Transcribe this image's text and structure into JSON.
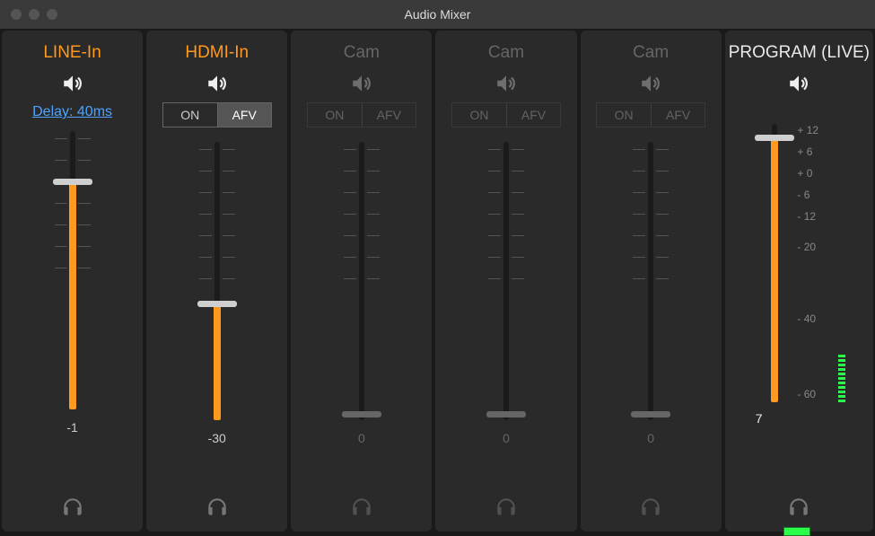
{
  "window": {
    "title": "Audio Mixer"
  },
  "channels": [
    {
      "id": "line-in",
      "title": "LINE-In",
      "titleClass": "on",
      "speakerActive": true,
      "hasDelay": true,
      "delay": "Delay: 40ms",
      "hasButtons": false,
      "value": "-1",
      "fillPct": 82,
      "active": true
    },
    {
      "id": "hdmi-in",
      "title": "HDMI-In",
      "titleClass": "on",
      "speakerActive": true,
      "hasButtons": true,
      "btnOn": "ON",
      "btnAfv": "AFV",
      "btnSel": "afv",
      "value": "-30",
      "fillPct": 42,
      "active": true
    },
    {
      "id": "cam1",
      "title": "Cam",
      "titleClass": "",
      "speakerActive": false,
      "hasButtons": true,
      "btnOn": "ON",
      "btnAfv": "AFV",
      "btnSel": "",
      "value": "0",
      "fillPct": 0,
      "active": false
    },
    {
      "id": "cam2",
      "title": "Cam",
      "titleClass": "",
      "speakerActive": false,
      "hasButtons": true,
      "btnOn": "ON",
      "btnAfv": "AFV",
      "btnSel": "",
      "value": "0",
      "fillPct": 0,
      "active": false
    },
    {
      "id": "cam3",
      "title": "Cam",
      "titleClass": "",
      "speakerActive": false,
      "hasButtons": true,
      "btnOn": "ON",
      "btnAfv": "AFV",
      "btnSel": "",
      "value": "0",
      "fillPct": 0,
      "active": false
    }
  ],
  "program": {
    "title": "PROGRAM (LIVE)",
    "value": "7",
    "fillPct": 95,
    "scale": [
      "+ 12",
      "+ 6",
      "+ 0",
      "- 6",
      "- 12",
      "- 20",
      "- 40",
      "- 60"
    ],
    "meterSegments": 11
  }
}
